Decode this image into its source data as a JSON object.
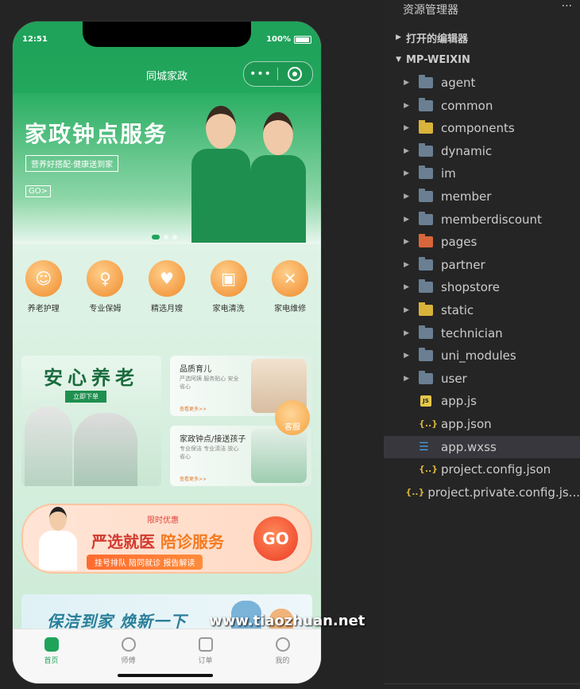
{
  "phone": {
    "status_time": "12:51",
    "status_battery": "100%",
    "nav_title": "同城家政",
    "capsule_dots": "•••"
  },
  "banner": {
    "headline": "家政钟点服务",
    "subtitle": "营养好搭配·健康送到家",
    "go_label": "GO>"
  },
  "categories": [
    {
      "label": "养老护理",
      "icon": "elder-care-icon"
    },
    {
      "label": "专业保姆",
      "icon": "nanny-icon"
    },
    {
      "label": "精选月嫂",
      "icon": "maternity-nurse-icon"
    },
    {
      "label": "家电清洗",
      "icon": "appliance-wash-icon"
    },
    {
      "label": "家电维修",
      "icon": "repair-icon"
    }
  ],
  "card_left": {
    "title": "安心养老",
    "button": "立即下单"
  },
  "card_right_top": {
    "title": "品质育儿",
    "desc": "严选阿姨 服务贴心 安全省心",
    "more": "查看更多>>"
  },
  "card_right_bottom": {
    "title": "家政钟点/接送孩子",
    "desc": "专业保洁 专业清洁 放心省心",
    "more": "查看更多>>"
  },
  "kefu_label": "客服",
  "promo": {
    "tag": "限时优惠",
    "main": "严选就医",
    "highlight": "陪诊服务",
    "strip": "挂号排队 陪同就诊 报告解读",
    "go": "GO"
  },
  "clean_banner": {
    "title": "保洁到家 焕新一下"
  },
  "watermark": "www.tiaozhuan.net",
  "tabs": [
    {
      "label": "首页",
      "active": true
    },
    {
      "label": "师傅",
      "active": false
    },
    {
      "label": "订单",
      "active": false
    },
    {
      "label": "我的",
      "active": false
    }
  ],
  "explorer": {
    "header": "资源管理器",
    "more": "···",
    "open_editors": "打开的编辑器",
    "project": "MP-WEIXIN",
    "items": [
      {
        "name": "agent",
        "type": "folder"
      },
      {
        "name": "common",
        "type": "folder"
      },
      {
        "name": "components",
        "type": "folder-yellow"
      },
      {
        "name": "dynamic",
        "type": "folder"
      },
      {
        "name": "im",
        "type": "folder"
      },
      {
        "name": "member",
        "type": "folder"
      },
      {
        "name": "memberdiscount",
        "type": "folder"
      },
      {
        "name": "pages",
        "type": "folder-orange"
      },
      {
        "name": "partner",
        "type": "folder"
      },
      {
        "name": "shopstore",
        "type": "folder"
      },
      {
        "name": "static",
        "type": "folder-yellow"
      },
      {
        "name": "technician",
        "type": "folder"
      },
      {
        "name": "uni_modules",
        "type": "folder"
      },
      {
        "name": "user",
        "type": "folder"
      },
      {
        "name": "app.js",
        "type": "js"
      },
      {
        "name": "app.json",
        "type": "json"
      },
      {
        "name": "app.wxss",
        "type": "css",
        "selected": true
      },
      {
        "name": "project.config.json",
        "type": "json"
      },
      {
        "name": "project.private.config.js...",
        "type": "json"
      }
    ]
  }
}
